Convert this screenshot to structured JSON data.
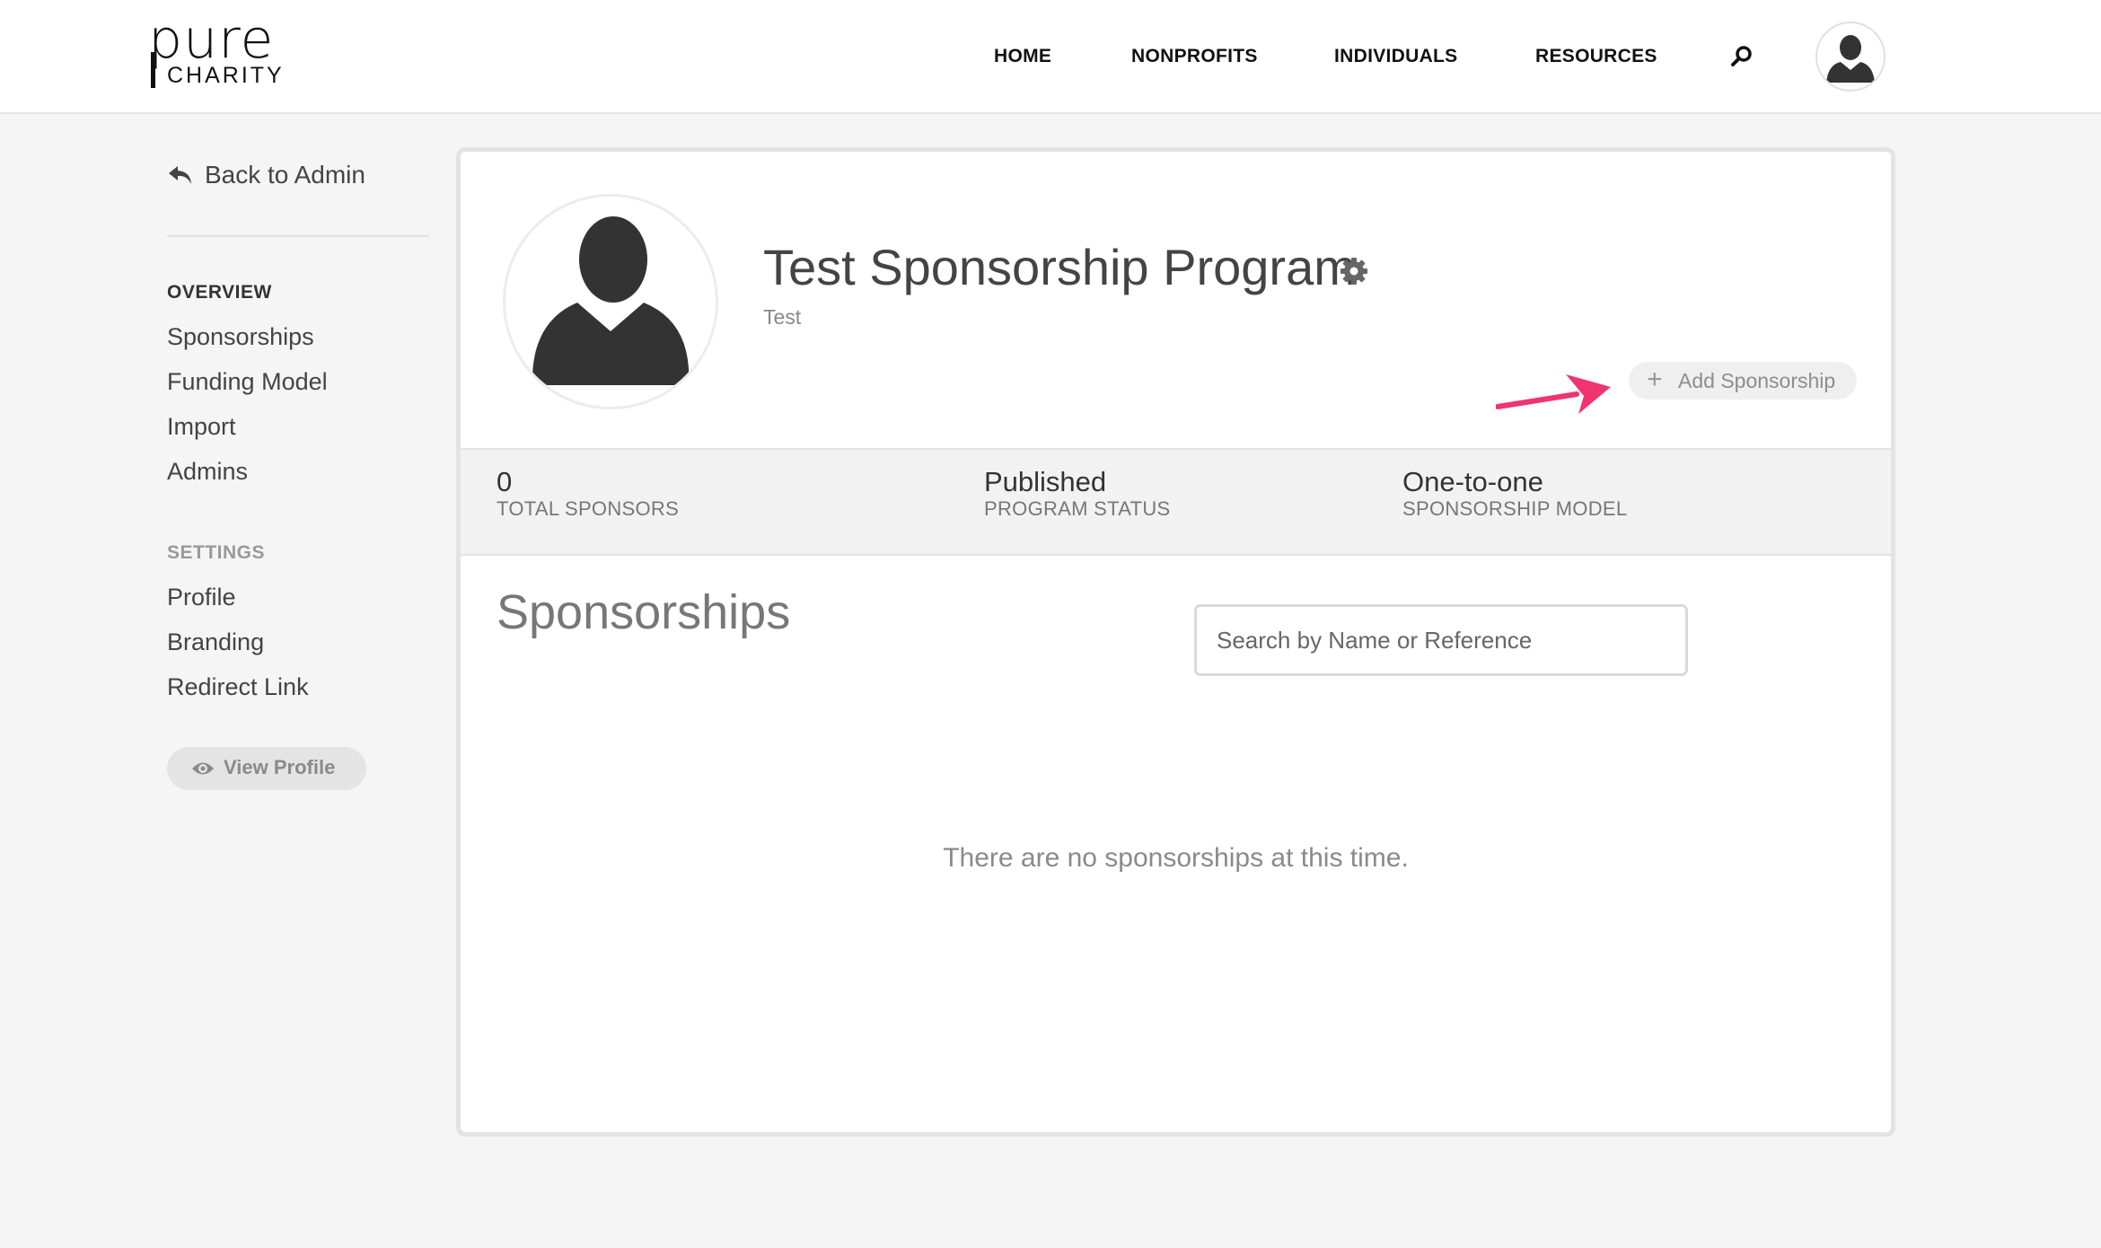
{
  "brand": {
    "word_top": "pure",
    "word_bottom": "CHARITY"
  },
  "nav": {
    "items": [
      {
        "label": "HOME"
      },
      {
        "label": "NONPROFITS"
      },
      {
        "label": "INDIVIDUALS"
      },
      {
        "label": "RESOURCES"
      }
    ],
    "search_icon": "search-icon",
    "avatar_icon": "user-avatar-icon"
  },
  "sidebar": {
    "back_label": "Back to Admin",
    "overview_heading": "OVERVIEW",
    "overview_items": [
      "Sponsorships",
      "Funding Model",
      "Import",
      "Admins"
    ],
    "settings_heading": "SETTINGS",
    "settings_items": [
      "Profile",
      "Branding",
      "Redirect Link"
    ],
    "view_profile_label": "View Profile"
  },
  "program": {
    "title": "Test Sponsorship Program",
    "subtitle": "Test",
    "add_button_label": "Add Sponsorship"
  },
  "stats": [
    {
      "value": "0",
      "label": "TOTAL SPONSORS"
    },
    {
      "value": "Published",
      "label": "PROGRAM STATUS"
    },
    {
      "value": "One-to-one",
      "label": "SPONSORSHIP MODEL"
    }
  ],
  "sponsorships": {
    "title": "Sponsorships",
    "search_placeholder": "Search by Name or Reference",
    "search_value": "",
    "empty_message": "There are no sponsorships at this time."
  },
  "colors": {
    "page_bg": "#f5f5f5",
    "annotation_arrow": "#f0346f",
    "heading_dark": "#333333",
    "heading_muted": "#999999"
  }
}
